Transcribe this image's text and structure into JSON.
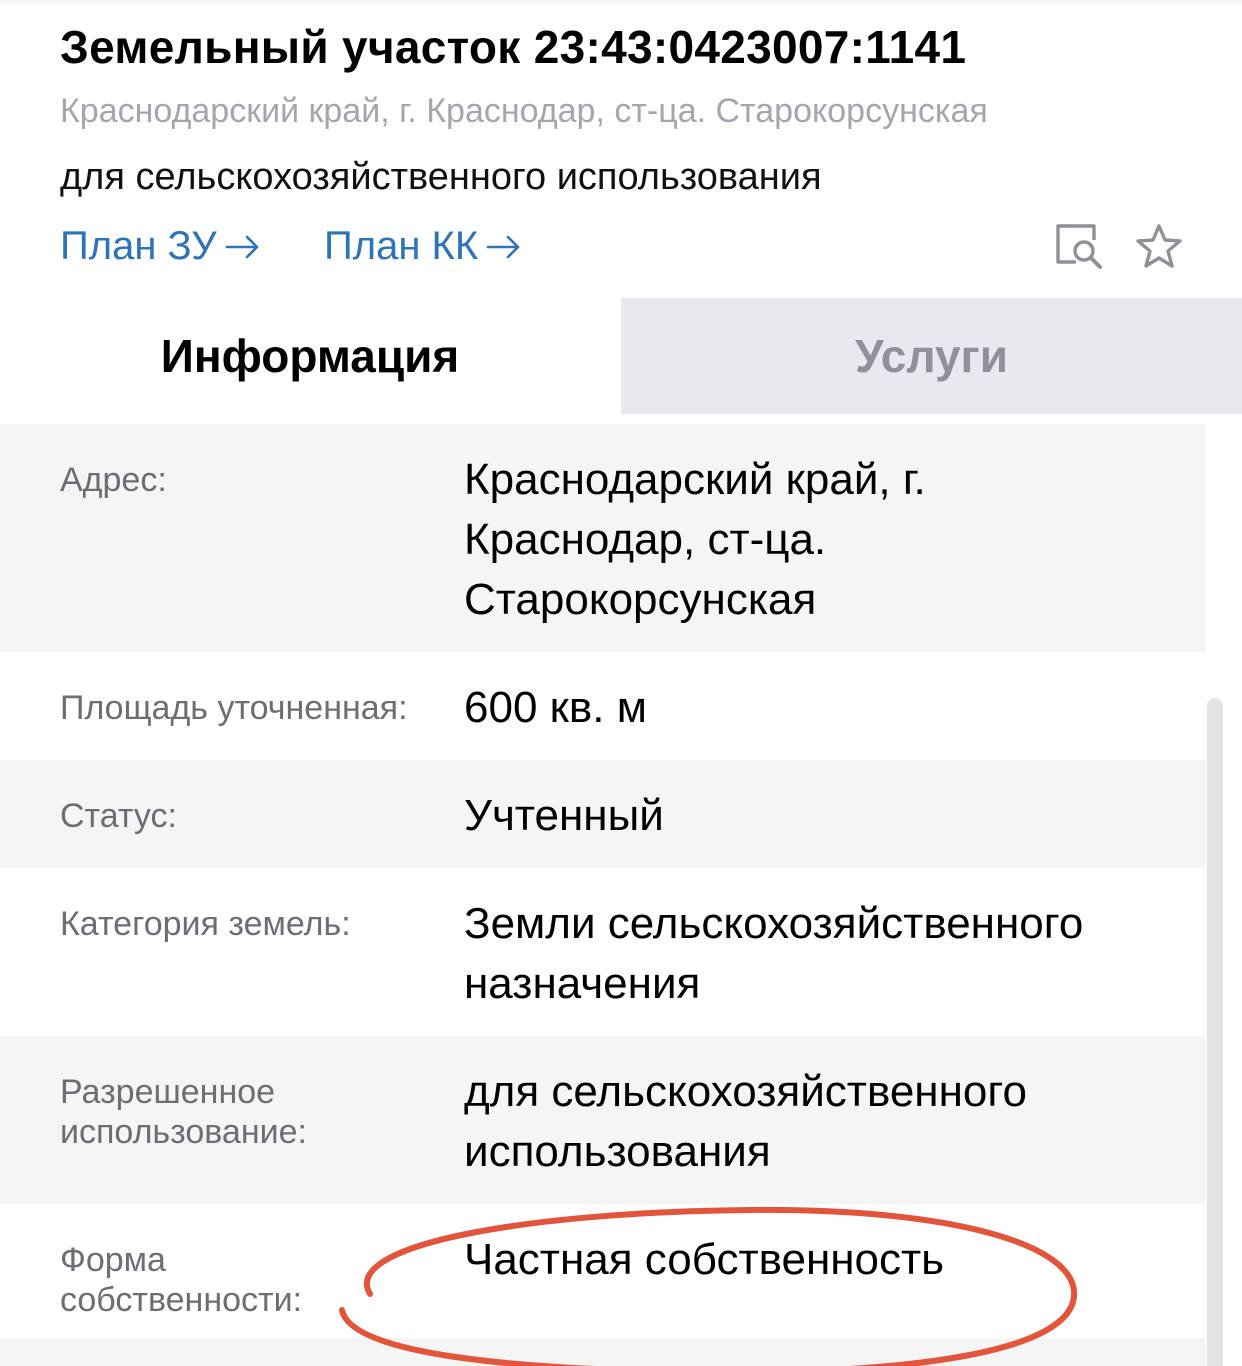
{
  "header": {
    "title": "Земельный участок 23:43:0423007:1141",
    "address": "Краснодарский край, г. Краснодар, ст-ца. Старокорсунская",
    "purpose": "для сельскохозяйственного использования",
    "links": [
      {
        "label": "План ЗУ",
        "icon": "arrow-right-icon"
      },
      {
        "label": "План КК",
        "icon": "arrow-right-icon"
      }
    ],
    "actions": [
      {
        "icon": "document-search-icon"
      },
      {
        "icon": "star-icon"
      }
    ]
  },
  "tabs": [
    {
      "label": "Информация",
      "active": true
    },
    {
      "label": "Услуги",
      "active": false
    }
  ],
  "info": [
    {
      "label": "Адрес:",
      "value": "Краснодарский край, г. Краснодар, ст-ца. Старокорсунская"
    },
    {
      "label": "Площадь уточненная:",
      "value": "600 кв. м"
    },
    {
      "label": "Статус:",
      "value": "Учтенный"
    },
    {
      "label": "Категория земель:",
      "value": "Земли сельскохозяйственного назначения"
    },
    {
      "label": "Разрешенное использование:",
      "value": "для сельскохозяйственного использования"
    },
    {
      "label": "Форма собственности:",
      "value": "Частная собственность"
    }
  ],
  "colors": {
    "link": "#2d73b7",
    "highlight_ellipse": "#e2553a",
    "inactive_tab_bg": "#e8e9ee",
    "row_shade": "#f5f5f5"
  }
}
